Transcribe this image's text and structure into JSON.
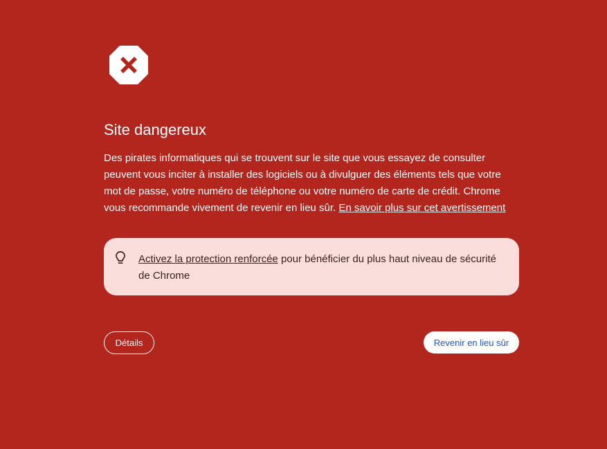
{
  "warning": {
    "icon": "stop-x-icon",
    "title": "Site dangereux",
    "description": "Des pirates informatiques qui se trouvent sur le site que vous essayez de consulter peuvent vous inciter à installer des logiciels ou à divulguer des éléments tels que votre mot de passe, votre numéro de téléphone ou votre numéro de carte de crédit. Chrome vous recommande vivement de revenir en lieu sûr.",
    "learn_more_link": "En savoir plus sur cet avertissement"
  },
  "tip": {
    "icon": "lightbulb-icon",
    "link": "Activez la protection renforcée",
    "text": " pour bénéficier du plus haut niveau de sécurité de Chrome"
  },
  "buttons": {
    "details": "Détails",
    "back": "Revenir en lieu sûr"
  },
  "colors": {
    "background": "#b3261e",
    "tip_background": "#fadedb",
    "primary_button_text": "#1a56c5"
  }
}
